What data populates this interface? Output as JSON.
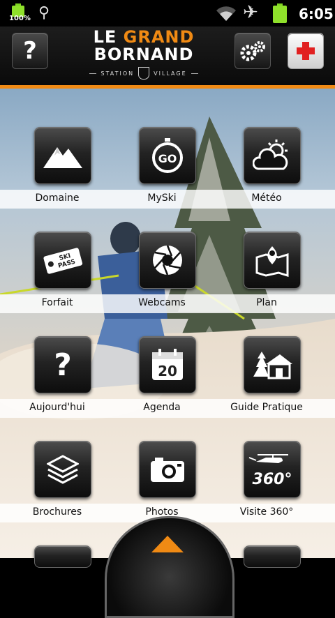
{
  "statusbar": {
    "battery_percent": "100%",
    "time": "6:05"
  },
  "header": {
    "logo_line1_a": "LE",
    "logo_line1_b": "GRAND",
    "logo_line2": "BORNAND",
    "logo_line3_a": "STATION",
    "logo_line3_b": "VILLAGE",
    "help_symbol": "?",
    "accent_color": "#f08a14"
  },
  "grid": {
    "items": [
      {
        "label": "Domaine",
        "icon": "mountain-icon"
      },
      {
        "label": "MySki",
        "icon": "go-icon",
        "icon_text": "GO"
      },
      {
        "label": "Météo",
        "icon": "weather-icon"
      },
      {
        "label": "Forfait",
        "icon": "ski-pass-icon",
        "icon_text": "SKI PASS"
      },
      {
        "label": "Webcams",
        "icon": "camera-aperture-icon"
      },
      {
        "label": "Plan",
        "icon": "map-pin-icon"
      },
      {
        "label": "Aujourd'hui",
        "icon": "question-icon",
        "icon_text": "?"
      },
      {
        "label": "Agenda",
        "icon": "calendar-icon",
        "icon_text": "20"
      },
      {
        "label": "Guide Pratique",
        "icon": "chalet-icon"
      },
      {
        "label": "Brochures",
        "icon": "layers-icon"
      },
      {
        "label": "Photos",
        "icon": "photo-camera-icon"
      },
      {
        "label": "Visite 360°",
        "icon": "helicopter-360-icon",
        "icon_text": "360°"
      }
    ]
  }
}
